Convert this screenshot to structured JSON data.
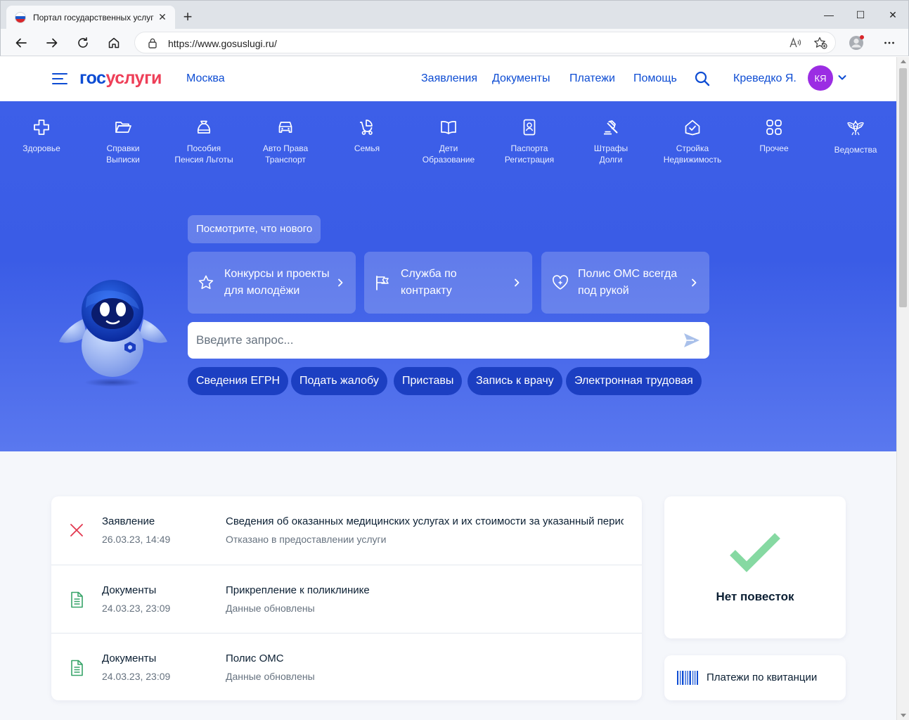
{
  "browser": {
    "tab_title": "Портал государственных услуг Российской Федерации",
    "url": "https://www.gosuslugi.ru/",
    "new_tab": "+",
    "close_tab": "✕",
    "minimize": "—",
    "maximize": "☐",
    "close_window": "✕"
  },
  "header": {
    "logo_part1": "гос",
    "logo_part2": "услуги",
    "city": "Москва",
    "nav": [
      "Заявления",
      "Документы",
      "Платежи",
      "Помощь"
    ],
    "user_name": "Креведко Я.",
    "user_initials": "КЯ"
  },
  "categories": [
    {
      "icon": "plus-cross-icon",
      "label": "Здоровье"
    },
    {
      "icon": "folder-icon",
      "label": "Справки\nВыписки"
    },
    {
      "icon": "money-bag-icon",
      "label": "Пособия\nПенсия Льготы"
    },
    {
      "icon": "car-icon",
      "label": "Авто Права\nТранспорт"
    },
    {
      "icon": "stroller-icon",
      "label": "Семья"
    },
    {
      "icon": "book-icon",
      "label": "Дети\nОбразование"
    },
    {
      "icon": "passport-icon",
      "label": "Паспорта\nРегистрация"
    },
    {
      "icon": "gavel-icon",
      "label": "Штрафы\nДолги"
    },
    {
      "icon": "house-check-icon",
      "label": "Стройка\nНедвижимость"
    },
    {
      "icon": "grid-icon",
      "label": "Прочее"
    },
    {
      "icon": "eagle-emblem-icon",
      "label": "Ведомства"
    }
  ],
  "hero": {
    "whats_new": "Посмотрите, что нового",
    "promos": [
      {
        "icon": "star-icon",
        "text": "Конкурсы и проекты для молодёжи"
      },
      {
        "icon": "flag-icon",
        "text": "Служба по контракту"
      },
      {
        "icon": "heart-plus-icon",
        "text": "Полис ОМС всегда под рукой"
      }
    ],
    "search_placeholder": "Введите запрос...",
    "chips": [
      "Сведения ЕГРН",
      "Подать жалобу",
      "Приставы",
      "Запись к врачу",
      "Электронная трудовая"
    ]
  },
  "feed": [
    {
      "icon": "rejected-x-icon",
      "type": "Заявление",
      "date": "26.03.23, 14:49",
      "title": "Сведения об оказанных медицинских услугах и их стоимости за указанный период",
      "status": "Отказано в предоставлении услуги"
    },
    {
      "icon": "document-icon",
      "type": "Документы",
      "date": "24.03.23, 23:09",
      "title": "Прикрепление к поликлинике",
      "status": "Данные обновлены"
    },
    {
      "icon": "document-icon",
      "type": "Документы",
      "date": "24.03.23, 23:09",
      "title": "Полис ОМС",
      "status": "Данные обновлены"
    }
  ],
  "summons": {
    "text": "Нет повесток"
  },
  "payment": {
    "text": "Платежи по квитанции"
  },
  "colors": {
    "brand_blue": "#0d4cd3",
    "brand_red": "#ee3f58",
    "hero_blue": "#3d5fe8",
    "chip_blue": "#1c3fc2",
    "avatar_purple": "#9b2de3",
    "success_green": "#86d9a2"
  }
}
